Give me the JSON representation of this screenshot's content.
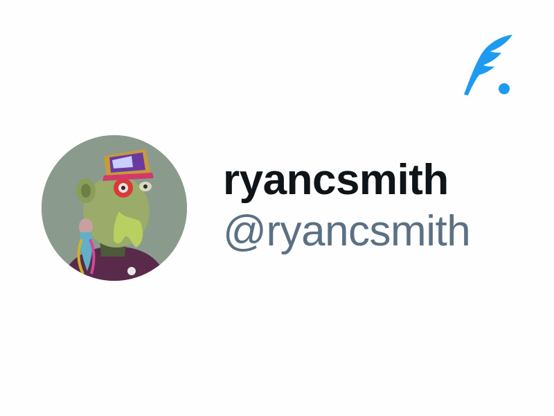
{
  "profile": {
    "display_name": "ryancsmith",
    "handle": "@ryancsmith",
    "avatar_alt": "avatar"
  },
  "brand": {
    "icon": "quill-icon",
    "color": "#1d9bf0"
  },
  "colors": {
    "display_name": "#0f1419",
    "handle": "#5b7083",
    "background": "#ffffff"
  }
}
